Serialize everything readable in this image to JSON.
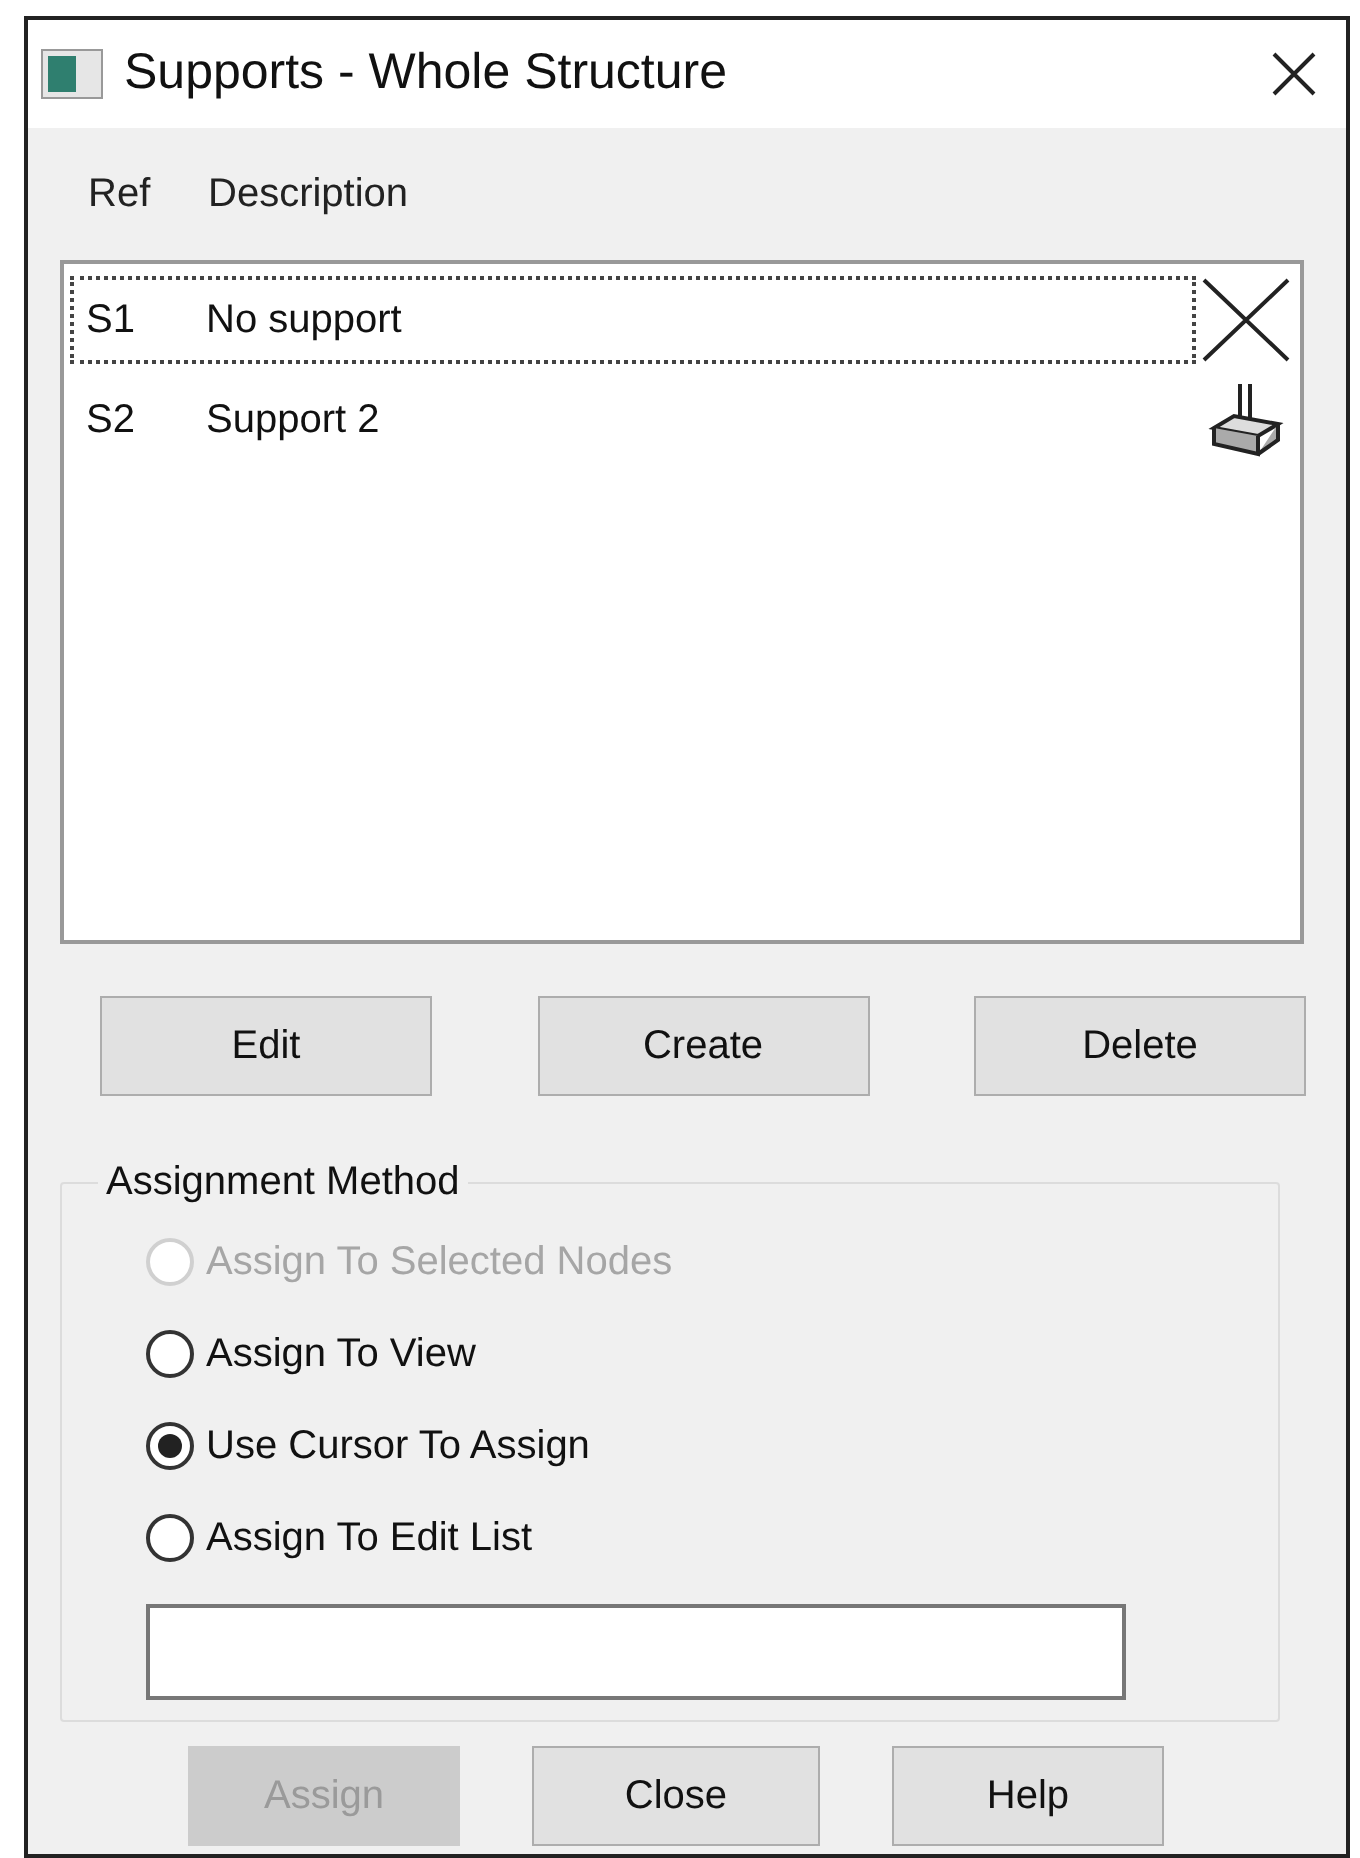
{
  "window": {
    "title": "Supports - Whole Structure"
  },
  "list": {
    "columns": [
      "Ref",
      "Description"
    ],
    "rows": [
      {
        "ref": "S1",
        "description": "No support",
        "kind": "none",
        "selected": true
      },
      {
        "ref": "S2",
        "description": "Support 2",
        "kind": "fixed",
        "selected": false
      }
    ]
  },
  "list_buttons": [
    {
      "label": "Edit",
      "disabled": false
    },
    {
      "label": "Create",
      "disabled": false
    },
    {
      "label": "Delete",
      "disabled": false
    }
  ],
  "assignment_method": {
    "title": "Assignment Method",
    "options": [
      {
        "label": "Assign To Selected Nodes",
        "selected": false,
        "disabled": true
      },
      {
        "label": "Assign To View",
        "selected": false,
        "disabled": false
      },
      {
        "label": "Use Cursor To Assign",
        "selected": true,
        "disabled": false
      },
      {
        "label": "Assign To Edit List",
        "selected": false,
        "disabled": false
      }
    ]
  },
  "buttons": [
    {
      "label": "Assign",
      "disabled": true
    },
    {
      "label": "Close",
      "disabled": false
    },
    {
      "label": "Help",
      "disabled": false
    }
  ]
}
